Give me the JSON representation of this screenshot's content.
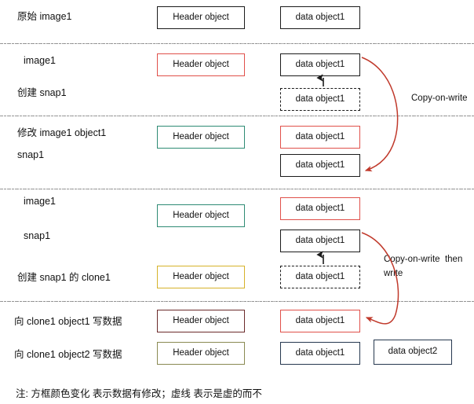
{
  "diagram": {
    "title_note": "注: 方框颜色变化 表示数据有修改；虚线 表示是虚的而不",
    "colors": {
      "black": "#1b1b1b",
      "red": "#e0504a",
      "dark_red": "#c0392b",
      "teal": "#2e8b74",
      "yellow": "#d6b22a",
      "maroon": "#6b2b2b",
      "olive": "#8a8a52",
      "navy": "#26384f",
      "arrow_red": "#c0392b",
      "separator": "#8a8a8a"
    },
    "rows": [
      {
        "id": "row-original",
        "labels": [
          "原始 image1"
        ],
        "boxes": [
          {
            "name": "header-object",
            "text": "Header object",
            "color": "black",
            "style": "solid"
          },
          {
            "name": "data-object",
            "text": "data object1",
            "color": "black",
            "style": "solid"
          }
        ]
      },
      {
        "id": "row-create-snap1",
        "labels": [
          "image1",
          "创建 snap1"
        ],
        "boxes": [
          {
            "name": "header-object",
            "text": "Header object",
            "color": "red",
            "style": "solid"
          },
          {
            "name": "data-object",
            "text": "data object1",
            "color": "black",
            "style": "solid"
          },
          {
            "name": "data-object-virtual",
            "text": "data object1",
            "color": "black",
            "style": "dashed"
          }
        ],
        "annotation": "Copy-on-write"
      },
      {
        "id": "row-modify-image1-object1",
        "labels": [
          "修改 image1 object1",
          "snap1"
        ],
        "boxes": [
          {
            "name": "header-object",
            "text": "Header object",
            "color": "teal",
            "style": "solid"
          },
          {
            "name": "data-object",
            "text": "data object1",
            "color": "red",
            "style": "solid"
          },
          {
            "name": "data-object",
            "text": "data object1",
            "color": "black",
            "style": "solid"
          }
        ]
      },
      {
        "id": "row-create-clone1",
        "labels": [
          "image1",
          "snap1",
          "创建 snap1 的 clone1"
        ],
        "boxes": [
          {
            "name": "header-object",
            "text": "Header object",
            "color": "teal",
            "style": "solid"
          },
          {
            "name": "header-object",
            "text": "Header object",
            "color": "yellow",
            "style": "solid"
          },
          {
            "name": "data-object",
            "text": "data object1",
            "color": "red",
            "style": "solid"
          },
          {
            "name": "data-object",
            "text": "data object1",
            "color": "black",
            "style": "solid"
          },
          {
            "name": "data-object-virtual",
            "text": "data object1",
            "color": "black",
            "style": "dashed"
          }
        ],
        "annotation": "Copy-on-write  then\nwrite"
      },
      {
        "id": "row-write-clone1-object1",
        "labels": [
          "向 clone1 object1 写数据"
        ],
        "boxes": [
          {
            "name": "header-object",
            "text": "Header object",
            "color": "maroon",
            "style": "solid"
          },
          {
            "name": "data-object",
            "text": "data object1",
            "color": "red",
            "style": "solid"
          }
        ]
      },
      {
        "id": "row-write-clone1-object2",
        "labels": [
          "向 clone1 object2 写数据"
        ],
        "boxes": [
          {
            "name": "header-object",
            "text": "Header object",
            "color": "olive",
            "style": "solid"
          },
          {
            "name": "data-object",
            "text": "data object1",
            "color": "navy",
            "style": "solid"
          },
          {
            "name": "data-object",
            "text": "data object2",
            "color": "navy",
            "style": "solid"
          }
        ]
      }
    ],
    "row_labels": {
      "r1_c1": "原始 image1",
      "r2_c1": "image1",
      "r2_c2": "创建 snap1",
      "r3_c1": "修改 image1 object1",
      "r3_c2": "snap1",
      "r4_c1": "image1",
      "r4_c2": "snap1",
      "r4_c3": "创建 snap1 的 clone1",
      "r5_c1": "向 clone1 object1 写数据",
      "r6_c1": "向 clone1 object2 写数据"
    },
    "box_text": {
      "header": "Header object",
      "data1": "data object1",
      "data2": "data object2"
    },
    "annotations": {
      "cow": "Copy-on-write",
      "cow_then_write_line1": "Copy-on-write  then",
      "cow_then_write_line2": "write"
    }
  }
}
